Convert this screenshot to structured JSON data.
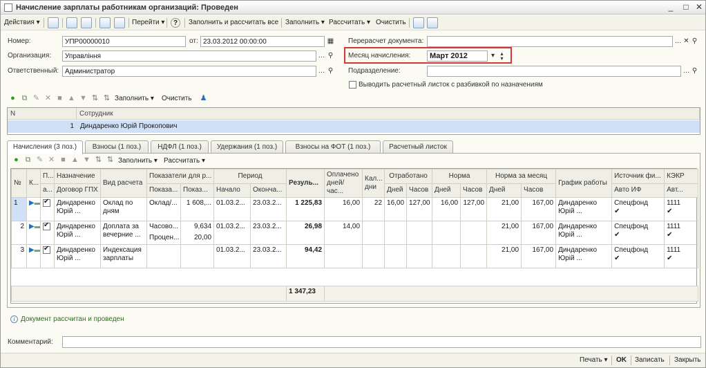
{
  "window": {
    "title": "Начисление зарплаты работникам организаций: Проведен",
    "minimize": "_",
    "maximize": "□",
    "close": "✕"
  },
  "toolbar": {
    "actions": "Действия",
    "goto": "Перейти",
    "help": "?",
    "fill_calc_all": "Заполнить и рассчитать все",
    "fill": "Заполнить",
    "calculate": "Рассчитать",
    "clear": "Очистить"
  },
  "header": {
    "number_label": "Номер:",
    "number_value": "УПР00000010",
    "from_label": "от:",
    "date_value": "23.03.2012 00:00:00",
    "org_label": "Организация:",
    "org_value": "Управління",
    "resp_label": "Ответственный:",
    "resp_value": "Администратор",
    "recalc_label": "Перерасчет документа:",
    "recalc_value": "",
    "month_label": "Месяц начисления:",
    "month_value": "Март 2012",
    "dept_label": "Подразделение:",
    "dept_value": "",
    "print_sheet_label": "Выводить расчетный листок с разбивкой по назначениям",
    "print_sheet_checked": false
  },
  "employees_bar": {
    "fill": "Заполнить",
    "clear": "Очистить"
  },
  "employees_table": {
    "col_n": "N",
    "col_employee": "Сотрудник",
    "rows": [
      {
        "n": "1",
        "employee": "Диндаренко Юрій Прокопович"
      }
    ]
  },
  "tabs": [
    {
      "label": "Начисления (3 поз.)",
      "active": true
    },
    {
      "label": "Взносы (1 поз.)",
      "active": false
    },
    {
      "label": "НДФЛ (1 поз.)",
      "active": false
    },
    {
      "label": "Удержания (1 поз.)",
      "active": false
    },
    {
      "label": "Взносы на ФОТ (1 поз.)",
      "active": false
    },
    {
      "label": "Расчетный листок",
      "active": false
    }
  ],
  "accruals_bar": {
    "fill": "Заполнить",
    "calculate": "Рассчитать"
  },
  "accruals_headers": {
    "num": "№",
    "k": "К...",
    "p": "П...",
    "p2": "а...",
    "assignment": "Назначение",
    "contract": "Договор ГПХ",
    "calc_type": "Вид расчета",
    "indicators": "Показатели для р...",
    "ind1": "Показа...",
    "ind2": "Показ...",
    "period": "Период",
    "start": "Начало",
    "end": "Оконча...",
    "result": "Резуль...",
    "paid": "Оплачено дней/час...",
    "cal_days": "Кал... дни",
    "worked": "Отработано",
    "norm": "Норма",
    "norm_month": "Норма за месяц",
    "days": "Дней",
    "hours": "Часов",
    "schedule": "График работы",
    "source": "Источник фи...",
    "auto_if": "Авто ИФ",
    "kekr": "КЭКР",
    "kekr2": "Авт..."
  },
  "accruals_rows": [
    {
      "num": "1",
      "assignment": "Диндаренко Юрій ...",
      "calc_type": "Оклад по дням",
      "ind1": "Оклад/...",
      "ind2": "1 608,...",
      "ind1b": "",
      "ind2b": "",
      "start": "01.03.2...",
      "end": "23.03.2...",
      "result": "1 225,83",
      "paid": "16,00",
      "cal_days": "22",
      "worked_days": "16,00",
      "worked_hours": "127,00",
      "norm_days": "16,00",
      "norm_hours": "127,00",
      "month_days": "21,00",
      "month_hours": "167,00",
      "schedule": "Диндаренко Юрій ...",
      "source": "Спецфонд",
      "kekr": "1111"
    },
    {
      "num": "2",
      "assignment": "Диндаренко Юрій ...",
      "calc_type": "Доплата за вечерние ...",
      "ind1": "Часово...",
      "ind2": "9,634",
      "ind1b": "Процен...",
      "ind2b": "20,00",
      "start": "01.03.2...",
      "end": "23.03.2...",
      "result": "26,98",
      "paid": "14,00",
      "cal_days": "",
      "worked_days": "",
      "worked_hours": "",
      "norm_days": "",
      "norm_hours": "",
      "month_days": "21,00",
      "month_hours": "167,00",
      "schedule": "Диндаренко Юрій ...",
      "source": "Спецфонд",
      "kekr": "1111"
    },
    {
      "num": "3",
      "assignment": "Диндаренко Юрій ...",
      "calc_type": "Индексация зарплаты",
      "ind1": "",
      "ind2": "",
      "ind1b": "",
      "ind2b": "",
      "start": "01.03.2...",
      "end": "23.03.2...",
      "result": "94,42",
      "paid": "",
      "cal_days": "",
      "worked_days": "",
      "worked_hours": "",
      "norm_days": "",
      "norm_hours": "",
      "month_days": "21,00",
      "month_hours": "167,00",
      "schedule": "Диндаренко Юрій ...",
      "source": "Спецфонд",
      "kekr": "1111"
    }
  ],
  "accruals_total": "1 347,23",
  "status_text": "Документ рассчитан и проведен",
  "comment_label": "Комментарий:",
  "comment_value": "",
  "bottom": {
    "print": "Печать",
    "ok": "OK",
    "save": "Записать",
    "close": "Закрыть"
  },
  "colors": {
    "highlight_border": "#d23a3a",
    "selection": "#cfe0f7",
    "status_green": "#2a6f1f"
  }
}
